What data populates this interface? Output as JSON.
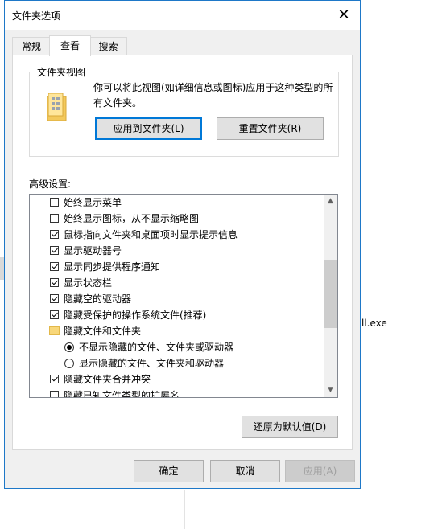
{
  "background": {
    "filename_fragment": "ll.exe"
  },
  "dialog": {
    "title": "文件夹选项",
    "close_glyph": "✕",
    "tabs": [
      {
        "label": "常规",
        "active": false
      },
      {
        "label": "查看",
        "active": true
      },
      {
        "label": "搜索",
        "active": false
      }
    ],
    "folder_views": {
      "legend": "文件夹视图",
      "description": "你可以将此视图(如详细信息或图标)应用于这种类型的所有文件夹。",
      "apply_button": "应用到文件夹(L)",
      "reset_button": "重置文件夹(R)"
    },
    "advanced": {
      "label": "高级设置:",
      "items": [
        {
          "type": "checkbox",
          "checked": false,
          "label": "始终显示菜单"
        },
        {
          "type": "checkbox",
          "checked": false,
          "label": "始终显示图标，从不显示缩略图"
        },
        {
          "type": "checkbox",
          "checked": true,
          "label": "鼠标指向文件夹和桌面项时显示提示信息"
        },
        {
          "type": "checkbox",
          "checked": true,
          "label": "显示驱动器号"
        },
        {
          "type": "checkbox",
          "checked": true,
          "label": "显示同步提供程序通知"
        },
        {
          "type": "checkbox",
          "checked": true,
          "label": "显示状态栏"
        },
        {
          "type": "checkbox",
          "checked": true,
          "label": "隐藏空的驱动器"
        },
        {
          "type": "checkbox",
          "checked": true,
          "label": "隐藏受保护的操作系统文件(推荐)"
        },
        {
          "type": "folder",
          "label": "隐藏文件和文件夹"
        },
        {
          "type": "radio",
          "checked": true,
          "label": "不显示隐藏的文件、文件夹或驱动器"
        },
        {
          "type": "radio",
          "checked": false,
          "label": "显示隐藏的文件、文件夹和驱动器"
        },
        {
          "type": "checkbox",
          "checked": true,
          "label": "隐藏文件夹合并冲突"
        },
        {
          "type": "checkbox",
          "checked": false,
          "label": "隐藏已知文件类型的扩展名"
        }
      ],
      "scroll_up_glyph": "▲",
      "scroll_down_glyph": "▼"
    },
    "restore_button": "还原为默认值(D)",
    "ok_button": "确定",
    "cancel_button": "取消",
    "apply_button": "应用(A)"
  }
}
